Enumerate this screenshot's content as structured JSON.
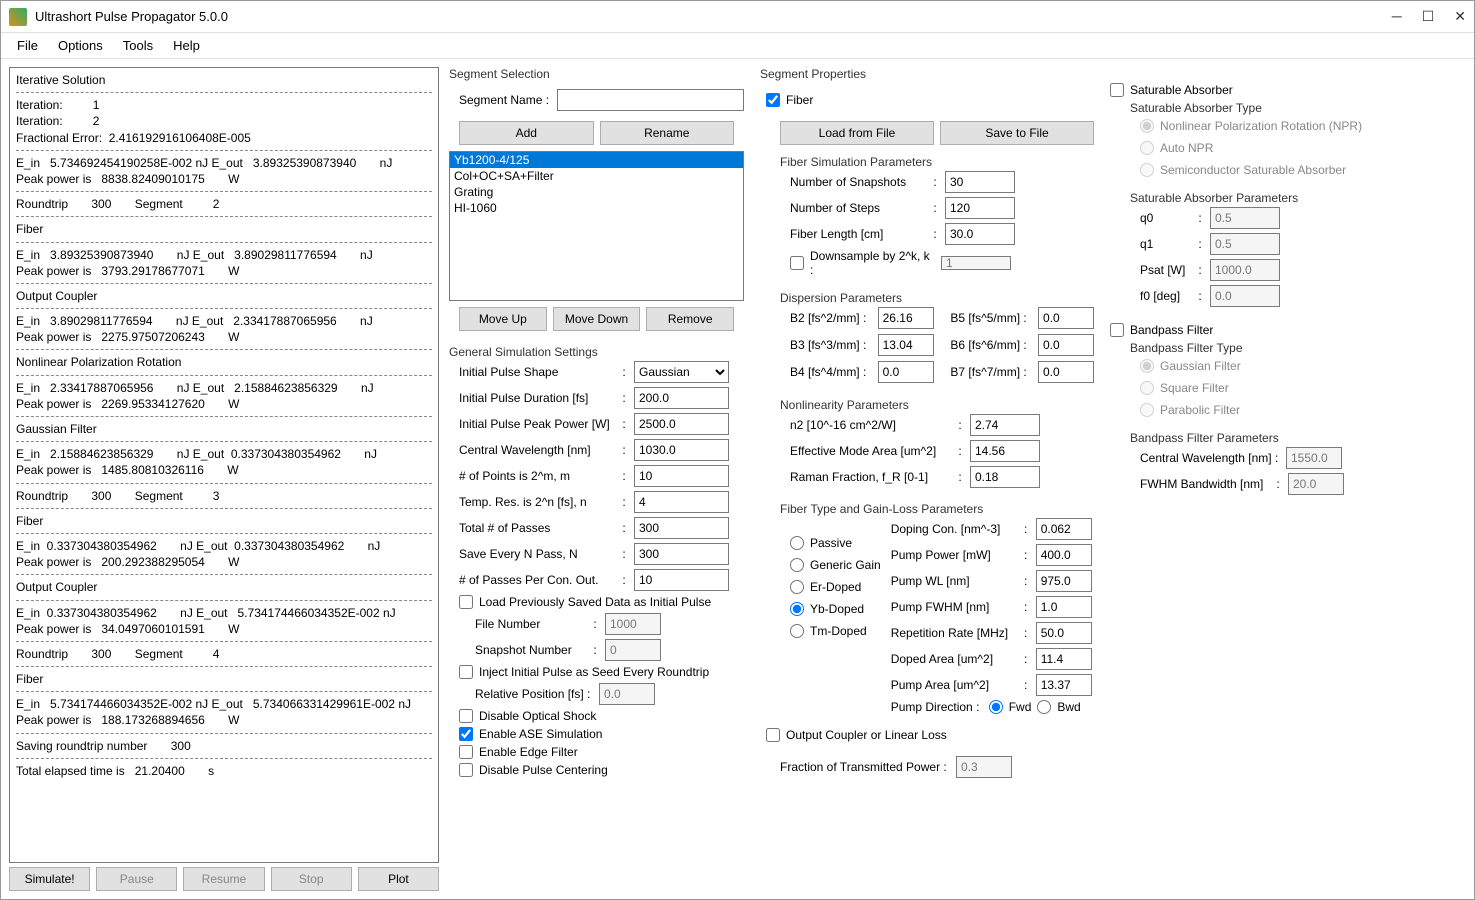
{
  "title": "Ultrashort Pulse Propagator 5.0.0",
  "menu": {
    "file": "File",
    "options": "Options",
    "tools": "Tools",
    "help": "Help"
  },
  "log": {
    "header": "Iterative Solution",
    "lines": [
      "Iteration:         1",
      "Iteration:         2",
      "Fractional Error:  2.416192916106408E-005",
      "---",
      "E_in   5.734692454190258E-002 nJ E_out   3.89325390873940       nJ",
      "Peak power is   8838.82409010175       W",
      "---",
      "Roundtrip       300       Segment         2",
      "---",
      "Fiber",
      "---",
      "E_in   3.89325390873940       nJ E_out   3.89029811776594       nJ",
      "Peak power is   3793.29178677071       W",
      "---",
      "Output Coupler",
      "---",
      "E_in   3.89029811776594       nJ E_out   2.33417887065956       nJ",
      "Peak power is   2275.97507206243       W",
      "---",
      "Nonlinear Polarization Rotation",
      "---",
      "E_in   2.33417887065956       nJ E_out   2.15884623856329       nJ",
      "Peak power is   2269.95334127620       W",
      "---",
      "Gaussian Filter",
      "---",
      "E_in   2.15884623856329       nJ E_out  0.337304380354962       nJ",
      "Peak power is   1485.80810326116       W",
      "---",
      "Roundtrip       300       Segment         3",
      "---",
      "Fiber",
      "---",
      "E_in  0.337304380354962       nJ E_out  0.337304380354962       nJ",
      "Peak power is   200.292388295054       W",
      "---",
      "Output Coupler",
      "---",
      "E_in  0.337304380354962       nJ E_out   5.734174466034352E-002 nJ",
      "Peak power is   34.0497060101591       W",
      "---",
      "Roundtrip       300       Segment         4",
      "---",
      "Fiber",
      "---",
      "E_in   5.734174466034352E-002 nJ E_out   5.734066331429961E-002 nJ",
      "Peak power is   188.173268894656       W",
      "---",
      "Saving roundtrip number       300",
      "---",
      "Total elapsed time is   21.20400       s"
    ]
  },
  "buttons": {
    "simulate": "Simulate!",
    "pause": "Pause",
    "resume": "Resume",
    "stop": "Stop",
    "plot": "Plot"
  },
  "segsel": {
    "title": "Segment Selection",
    "name_label": "Segment Name :",
    "name_val": "",
    "add": "Add",
    "rename": "Rename",
    "items": [
      "Yb1200-4/125",
      "Col+OC+SA+Filter",
      "Grating",
      "HI-1060"
    ],
    "moveup": "Move Up",
    "movedown": "Move Down",
    "remove": "Remove"
  },
  "gensim": {
    "title": "General Simulation Settings",
    "pulse_shape_label": "Initial Pulse Shape",
    "pulse_shape_val": "Gaussian",
    "pulse_dur_label": "Initial Pulse Duration [fs]",
    "pulse_dur_val": "200.0",
    "peak_pw_label": "Initial Pulse Peak Power [W]",
    "peak_pw_val": "2500.0",
    "cw_label": "Central Wavelength [nm]",
    "cw_val": "1030.0",
    "npoints_label": "# of Points is 2^m, m",
    "npoints_val": "10",
    "tres_label": "Temp. Res. is 2^n [fs], n",
    "tres_val": "4",
    "passes_label": "Total # of Passes",
    "passes_val": "300",
    "saven_label": "Save Every N Pass, N",
    "saven_val": "300",
    "pcon_label": "# of Passes Per Con. Out.",
    "pcon_val": "10",
    "load_prev": "Load Previously Saved Data as Initial Pulse",
    "filenum_label": "File Number",
    "filenum_val": "1000",
    "snapnum_label": "Snapshot Number",
    "snapnum_val": "0",
    "inject": "Inject Initial Pulse as Seed Every Roundtrip",
    "relpos_label": "Relative Position [fs] :",
    "relpos_val": "0.0",
    "disable_shock": "Disable Optical Shock",
    "enable_ase": "Enable ASE Simulation",
    "enable_edge": "Enable Edge Filter",
    "disable_center": "Disable Pulse Centering"
  },
  "segprops": {
    "title": "Segment Properties",
    "fiber": "Fiber",
    "load_file": "Load from File",
    "save_file": "Save to File",
    "fsp_title": "Fiber Simulation Parameters",
    "snap_label": "Number of Snapshots",
    "snap_val": "30",
    "steps_label": "Number of Steps",
    "steps_val": "120",
    "length_label": "Fiber Length [cm]",
    "length_val": "30.0",
    "downsample_label": "Downsample by 2^k, k :",
    "downsample_val": "1",
    "disp_title": "Dispersion Parameters",
    "b2_label": "B2 [fs^2/mm] :",
    "b2_val": "26.16",
    "b3_label": "B3 [fs^3/mm] :",
    "b3_val": "13.04",
    "b4_label": "B4 [fs^4/mm] :",
    "b4_val": "0.0",
    "b5_label": "B5 [fs^5/mm] :",
    "b5_val": "0.0",
    "b6_label": "B6 [fs^6/mm] :",
    "b6_val": "0.0",
    "b7_label": "B7 [fs^7/mm] :",
    "b7_val": "0.0",
    "nonlin_title": "Nonlinearity Parameters",
    "n2_label": "n2 [10^-16 cm^2/W]",
    "n2_val": "2.74",
    "mode_label": "Effective Mode Area [um^2]",
    "mode_val": "14.56",
    "raman_label": "Raman Fraction, f_R [0-1]",
    "raman_val": "0.18",
    "ftgl_title": "Fiber Type and Gain-Loss Parameters",
    "passive": "Passive",
    "generic": "Generic Gain",
    "er": "Er-Doped",
    "yb": "Yb-Doped",
    "tm": "Tm-Doped",
    "doping_label": "Doping Con. [nm^-3]",
    "doping_val": "0.062",
    "pumppw_label": "Pump Power [mW]",
    "pumppw_val": "400.0",
    "pumpwl_label": "Pump WL [nm]",
    "pumpwl_val": "975.0",
    "pumpfwhm_label": "Pump FWHM [nm]",
    "pumpfwhm_val": "1.0",
    "reprate_label": "Repetition Rate [MHz]",
    "reprate_val": "50.0",
    "dopedarea_label": "Doped Area [um^2]",
    "dopedarea_val": "11.4",
    "pumparea_label": "Pump Area [um^2]",
    "pumparea_val": "13.37",
    "pumpdir_label": "Pump Direction :",
    "fwd": "Fwd",
    "bwd": "Bwd",
    "oc_title": "Output Coupler or Linear Loss",
    "frac_label": "Fraction of Transmitted Power :",
    "frac_val": "0.3"
  },
  "sa": {
    "title": "Saturable Absorber",
    "type_title": "Saturable Absorber Type",
    "npr": "Nonlinear Polarization Rotation (NPR)",
    "auto": "Auto NPR",
    "semi": "Semiconductor Saturable Absorber",
    "params_title": "Saturable Absorber Parameters",
    "q0_label": "q0",
    "q0_val": "0.5",
    "q1_label": "q1",
    "q1_val": "0.5",
    "psat_label": "Psat [W]",
    "psat_val": "1000.0",
    "f0_label": "f0 [deg]",
    "f0_val": "0.0"
  },
  "bpf": {
    "title": "Bandpass Filter",
    "type_title": "Bandpass Filter Type",
    "gauss": "Gaussian Filter",
    "square": "Square Filter",
    "para": "Parabolic Filter",
    "params_title": "Bandpass Filter Parameters",
    "cw_label": "Central Wavelength [nm] :",
    "cw_val": "1550.0",
    "fwhm_label": "FWHM Bandwidth [nm]",
    "fwhm_val": "20.0"
  }
}
